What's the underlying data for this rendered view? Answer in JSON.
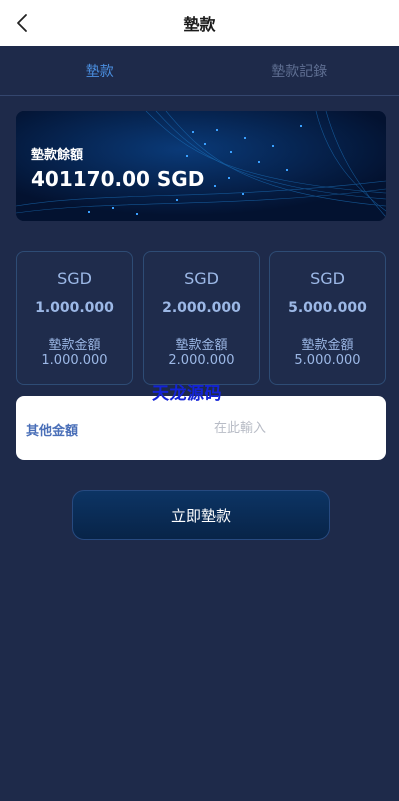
{
  "header": {
    "title": "墊款",
    "back_icon": "chevron-left-icon"
  },
  "tabs": [
    {
      "label": "墊款",
      "active": true
    },
    {
      "label": "墊款記錄",
      "active": false
    }
  ],
  "balance": {
    "label": "墊款餘額",
    "value": "401170.00 SGD"
  },
  "options": [
    {
      "currency": "SGD",
      "amount": "1.000.000",
      "label": "墊款金額",
      "sub": "1.000.000"
    },
    {
      "currency": "SGD",
      "amount": "2.000.000",
      "label": "墊款金額",
      "sub": "2.000.000"
    },
    {
      "currency": "SGD",
      "amount": "5.000.000",
      "label": "墊款金額",
      "sub": "5.000.000"
    }
  ],
  "watermark": "天龙源码",
  "other": {
    "label": "其他金額",
    "placeholder": "在此輸入",
    "value": ""
  },
  "submit": {
    "label": "立即墊款"
  },
  "colors": {
    "background": "#1e2a4a",
    "accent": "#4b8fe0",
    "card_text": "#9cb8e6",
    "button": "#0c3464"
  }
}
